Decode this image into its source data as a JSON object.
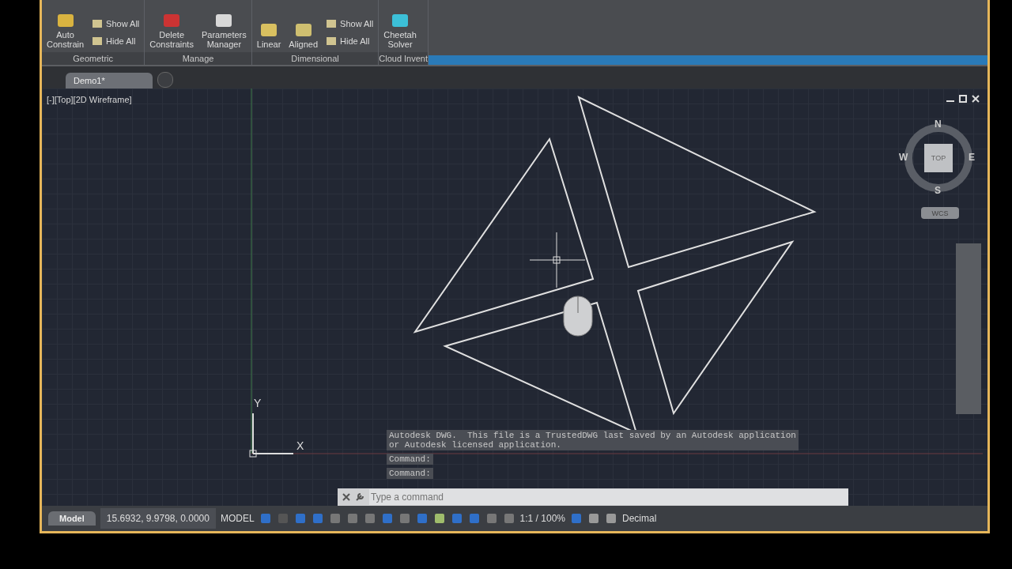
{
  "ribbon": {
    "panels": [
      {
        "title": "Geometric",
        "buttons": [
          {
            "label": "Auto\nConstrain",
            "kind": "large"
          },
          {
            "label": "Show All",
            "kind": "small"
          },
          {
            "label": "Hide All",
            "kind": "small"
          }
        ]
      },
      {
        "title": "Manage",
        "buttons": [
          {
            "label": "Delete\nConstraints",
            "kind": "large"
          },
          {
            "label": "Parameters\nManager",
            "kind": "large"
          }
        ]
      },
      {
        "title": "Dimensional",
        "buttons": [
          {
            "label": "Linear",
            "kind": "large"
          },
          {
            "label": "Aligned",
            "kind": "large"
          },
          {
            "label": "Show All",
            "kind": "small"
          },
          {
            "label": "Hide All",
            "kind": "small"
          }
        ]
      },
      {
        "title": "Cloud Invent",
        "buttons": [
          {
            "label": "Cheetah\nSolver",
            "kind": "large"
          }
        ]
      }
    ]
  },
  "document_tabs": [
    {
      "label": "Demo1*",
      "selected": true
    }
  ],
  "viewport": {
    "label": "[-][Top][2D Wireframe]",
    "viewcube": {
      "north": "N",
      "south": "S",
      "east": "E",
      "west": "W",
      "face": "TOP",
      "ucs": "WCS"
    },
    "axes": {
      "y": "Y",
      "x": "X"
    }
  },
  "command_line": {
    "history": [
      "Autodesk DWG.  This file is a TrustedDWG last saved by an Autodesk application\nor Autodesk licensed application.",
      "Command:",
      "Command:"
    ],
    "placeholder": "Type a command"
  },
  "status_bar": {
    "layout_tab": "Model",
    "coordinates": "15.6932, 9.9798, 0.0000",
    "space": "MODEL",
    "scale": "1:1 / 100%",
    "units": "Decimal"
  }
}
